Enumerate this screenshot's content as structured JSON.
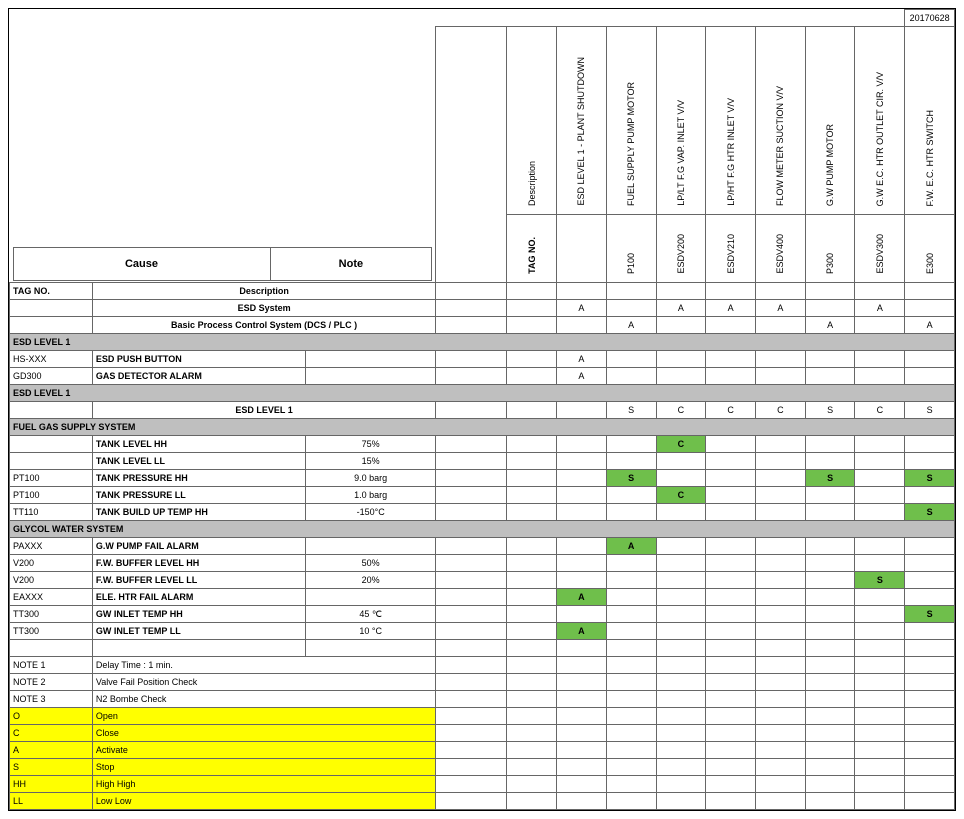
{
  "date": "20170628",
  "cause_header": "Cause",
  "note_header": "Note",
  "tag_label": "TAG NO.",
  "desc_label": "Description",
  "effect_headers": [
    {
      "tag": "TAG NO.",
      "desc": "Description"
    },
    {
      "tag": "",
      "desc": "ESD LEVEL 1 - PLANT SHUTDOWN"
    },
    {
      "tag": "P100",
      "desc": "FUEL SUPPLY PUMP MOTOR"
    },
    {
      "tag": "ESDV200",
      "desc": "LP/LT F.G VAP. INLET V/V"
    },
    {
      "tag": "ESDV210",
      "desc": "LP/HT F.G HTR INLET V/V"
    },
    {
      "tag": "ESDV400",
      "desc": "FLOW METER SUCTION V/V"
    },
    {
      "tag": "P300",
      "desc": "G.W PUMP MOTOR"
    },
    {
      "tag": "ESDV300",
      "desc": "G.W E.C. HTR OUTLET CIR. V/V"
    },
    {
      "tag": "E300",
      "desc": "F.W. E.C. HTR SWITCH"
    }
  ],
  "system_rows": [
    {
      "label": "ESD System",
      "cells": [
        "",
        "A",
        "",
        "A",
        "A",
        "A",
        "",
        "A",
        ""
      ]
    },
    {
      "label": "Basic Process Control System (DCS / PLC )",
      "cells": [
        "",
        "",
        "A",
        "",
        "",
        "",
        "A",
        "",
        "A"
      ]
    }
  ],
  "sections": [
    {
      "title": "ESD LEVEL 1",
      "rows": [
        {
          "tag": "HS-XXX",
          "desc": "ESD PUSH BUTTON",
          "note": "",
          "cells": [
            "",
            "A",
            "",
            "",
            "",
            "",
            "",
            "",
            ""
          ]
        },
        {
          "tag": "GD300",
          "desc": "GAS DETECTOR ALARM",
          "note": "",
          "cells": [
            "",
            "A",
            "",
            "",
            "",
            "",
            "",
            "",
            ""
          ]
        }
      ]
    },
    {
      "title": "ESD LEVEL 1",
      "rows": [
        {
          "tag": "",
          "desc": "ESD LEVEL 1",
          "note": "",
          "center_desc": true,
          "cells": [
            "",
            "",
            "S",
            "C",
            "C",
            "C",
            "S",
            "C",
            "S"
          ]
        }
      ]
    },
    {
      "title": "FUEL GAS SUPPLY SYSTEM",
      "rows": [
        {
          "tag": "",
          "desc": "TANK LEVEL HH",
          "note": "75%",
          "cells": [
            "",
            "",
            "",
            "C",
            "",
            "",
            "",
            "",
            ""
          ],
          "hl": [
            3
          ]
        },
        {
          "tag": "",
          "desc": "TANK LEVEL LL",
          "note": "15%",
          "cells": [
            "",
            "",
            "",
            "",
            "",
            "",
            "",
            "",
            ""
          ]
        },
        {
          "tag": "PT100",
          "desc": "TANK PRESSURE HH",
          "note": "9.0 barg",
          "cells": [
            "",
            "",
            "S",
            "",
            "",
            "",
            "S",
            "",
            "S"
          ],
          "hl": [
            2,
            6,
            8
          ]
        },
        {
          "tag": "PT100",
          "desc": "TANK PRESSURE LL",
          "note": "1.0 barg",
          "cells": [
            "",
            "",
            "",
            "C",
            "",
            "",
            "",
            "",
            ""
          ],
          "hl": [
            3
          ]
        },
        {
          "tag": "TT110",
          "desc": "TANK BUILD UP TEMP HH",
          "note": "-150°C",
          "cells": [
            "",
            "",
            "",
            "",
            "",
            "",
            "",
            "",
            "S"
          ],
          "hl": [
            8
          ]
        }
      ]
    },
    {
      "title": "GLYCOL WATER SYSTEM",
      "rows": [
        {
          "tag": "PAXXX",
          "desc": "G.W PUMP FAIL ALARM",
          "note": "",
          "cells": [
            "",
            "",
            "A",
            "",
            "",
            "",
            "",
            "",
            ""
          ],
          "hl": [
            2
          ]
        },
        {
          "tag": "V200",
          "desc": "F.W. BUFFER LEVEL HH",
          "note": "50%",
          "cells": [
            "",
            "",
            "",
            "",
            "",
            "",
            "",
            "",
            ""
          ]
        },
        {
          "tag": "V200",
          "desc": "F.W. BUFFER LEVEL LL",
          "note": "20%",
          "cells": [
            "",
            "",
            "",
            "",
            "",
            "",
            "",
            "S",
            ""
          ],
          "hl": [
            7
          ]
        },
        {
          "tag": "EAXXX",
          "desc": "ELE. HTR FAIL ALARM",
          "note": "",
          "cells": [
            "",
            "A",
            "",
            "",
            "",
            "",
            "",
            "",
            ""
          ],
          "hl": [
            1
          ]
        },
        {
          "tag": "TT300",
          "desc": "GW INLET TEMP HH",
          "note": "45 ℃",
          "cells": [
            "",
            "",
            "",
            "",
            "",
            "",
            "",
            "",
            "S"
          ],
          "hl": [
            8
          ]
        },
        {
          "tag": "TT300",
          "desc": "GW INLET TEMP LL",
          "note": "10 °C",
          "cells": [
            "",
            "A",
            "",
            "",
            "",
            "",
            "",
            "",
            ""
          ],
          "hl": [
            1
          ]
        }
      ]
    }
  ],
  "notes": [
    {
      "key": "NOTE 1",
      "val": "Delay Time : 1 min."
    },
    {
      "key": "NOTE 2",
      "val": "Valve Fail Position Check"
    },
    {
      "key": "NOTE 3",
      "val": "N2 Bombe Check"
    }
  ],
  "legend": [
    {
      "key": "O",
      "val": "Open"
    },
    {
      "key": "C",
      "val": "Close"
    },
    {
      "key": "A",
      "val": "Activate"
    },
    {
      "key": "S",
      "val": "Stop"
    },
    {
      "key": "HH",
      "val": "High High"
    },
    {
      "key": "LL",
      "val": "Low Low"
    }
  ]
}
